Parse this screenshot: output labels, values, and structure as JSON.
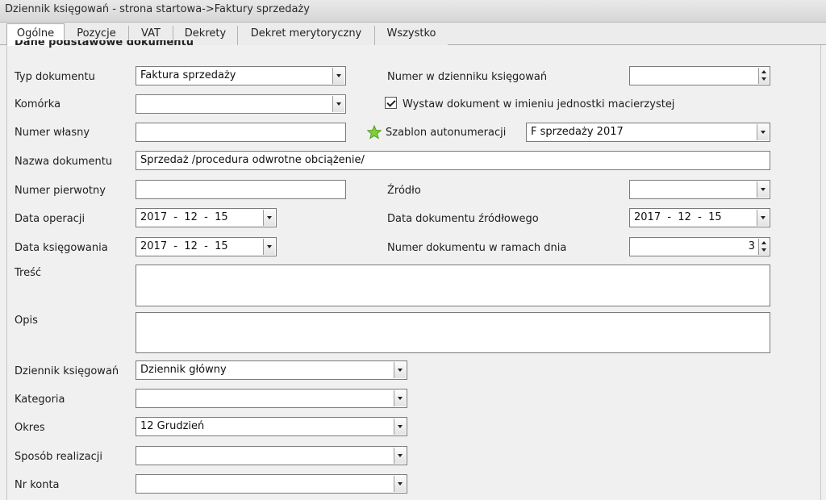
{
  "window": {
    "title": "Dziennik księgowań - strona startowa->Faktury sprzedaży"
  },
  "tabs": [
    {
      "label": "Ogólne"
    },
    {
      "label": "Pozycje"
    },
    {
      "label": "VAT"
    },
    {
      "label": "Dekrety"
    },
    {
      "label": "Dekret merytoryczny"
    },
    {
      "label": "Wszystko"
    }
  ],
  "group": {
    "title": "Dane podstawowe dokumentu"
  },
  "form": {
    "typ_dokumentu": {
      "label": "Typ dokumentu",
      "value": "Faktura sprzedaży"
    },
    "komorka": {
      "label": "Komórka",
      "value": ""
    },
    "numer_wlasny": {
      "label": "Numer własny",
      "value": ""
    },
    "nazwa_dokumentu": {
      "label": "Nazwa dokumentu",
      "value": "Sprzedaż /procedura odwrotne obciążenie/"
    },
    "numer_pierwotny": {
      "label": "Numer pierwotny",
      "value": ""
    },
    "data_operacji": {
      "label": "Data operacji",
      "value": "2017  -  12  -  15"
    },
    "data_ksiegowania": {
      "label": "Data księgowania",
      "value": "2017  -  12  -  15"
    },
    "tresc": {
      "label": "Treść",
      "value": ""
    },
    "opis": {
      "label": "Opis",
      "value": ""
    },
    "dziennik_ksiegowan": {
      "label": "Dziennik księgowań",
      "value": "Dziennik główny"
    },
    "kategoria": {
      "label": "Kategoria",
      "value": ""
    },
    "okres": {
      "label": "Okres",
      "value": "12 Grudzień"
    },
    "sposob_realizacji": {
      "label": "Sposób realizacji",
      "value": ""
    },
    "nr_konta": {
      "label": "Nr konta",
      "value": ""
    },
    "numer_w_dzienniku": {
      "label": "Numer w dzienniku księgowań",
      "value": ""
    },
    "wystaw_dokument": {
      "label": "Wystaw dokument w imieniu jednostki macierzystej",
      "checked": true
    },
    "szablon_autonumeracji": {
      "label": "Szablon autonumeracji",
      "value": "F sprzedaży 2017"
    },
    "zrodlo": {
      "label": "Źródło",
      "value": ""
    },
    "data_dokumentu_zrodlowego": {
      "label": "Data dokumentu źródłowego",
      "value": "2017  -  12  -  15"
    },
    "numer_dokumentu_w_ramach_dnia": {
      "label": "Numer dokumentu w ramach dnia",
      "value": "3"
    }
  },
  "colors": {
    "star_icon": "#7fcf3a",
    "field_border": "#7a7a7a",
    "background": "#f0f0f0"
  }
}
